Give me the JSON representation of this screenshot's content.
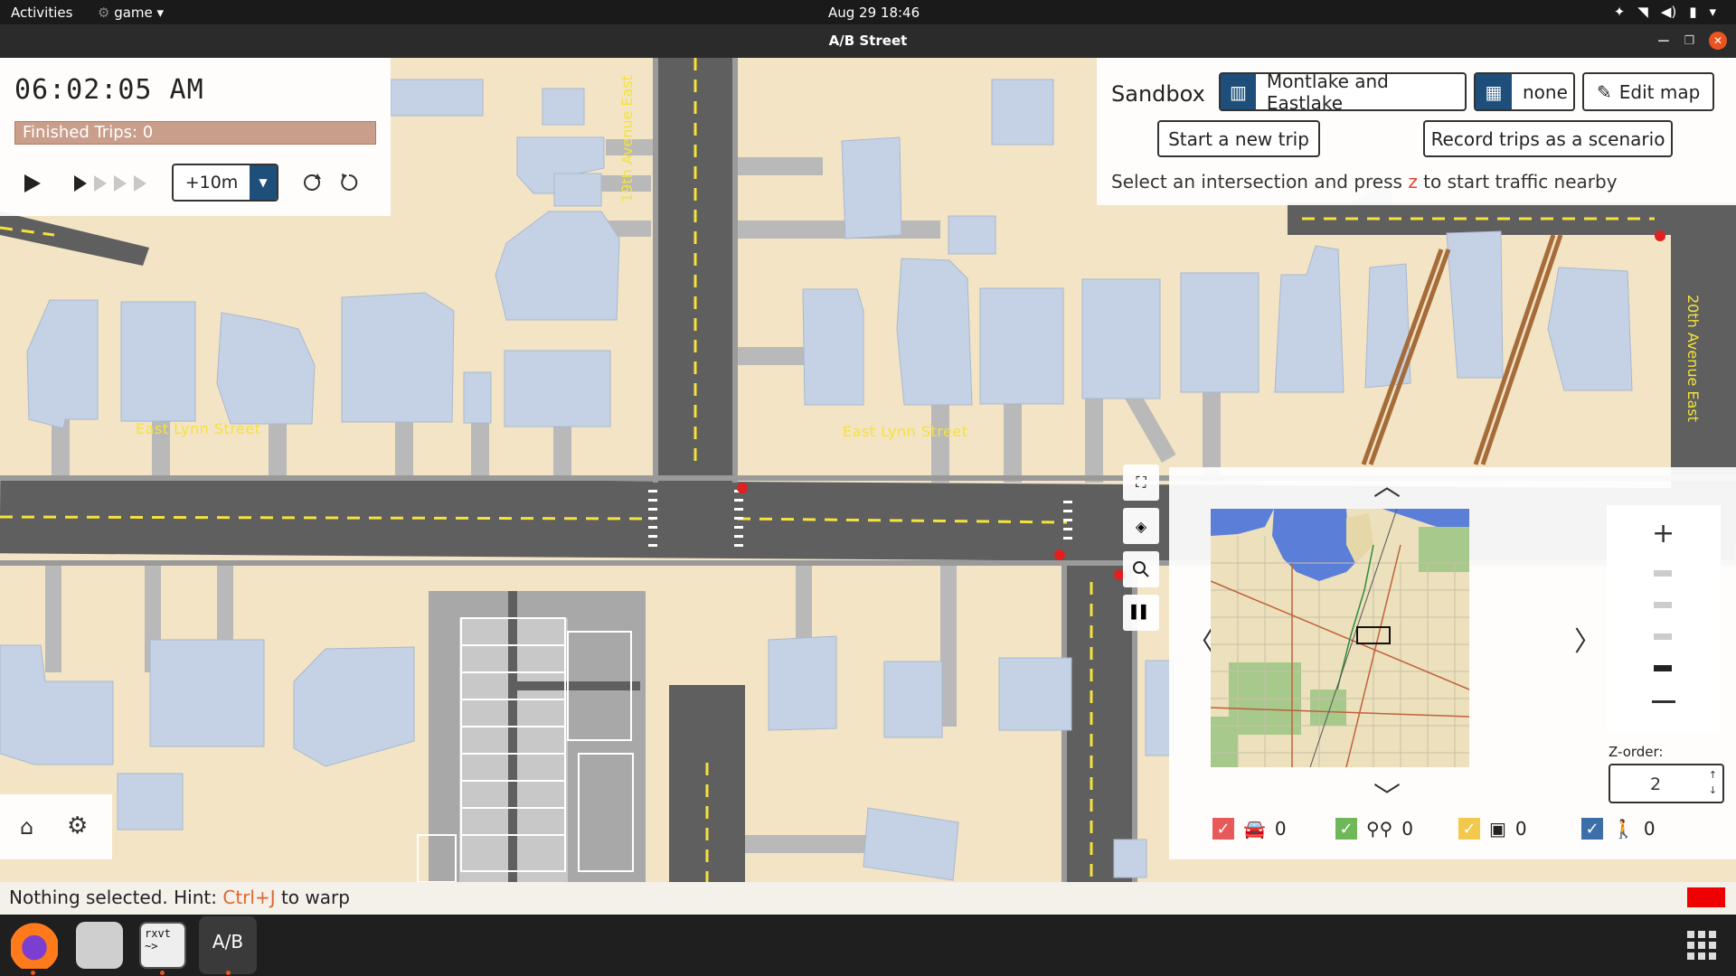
{
  "topbar": {
    "activities": "Activities",
    "app_menu": "game",
    "clock": "Aug 29  18:46"
  },
  "window": {
    "title": "A/B Street"
  },
  "time_panel": {
    "clock": "06:02:05 AM",
    "finished_trips": "Finished Trips: 0",
    "step_value": "+10m"
  },
  "sandbox": {
    "title": "Sandbox",
    "map_name": "Montlake and Eastlake",
    "scenario": "none",
    "edit_map": "Edit map",
    "start_trip": "Start a new trip",
    "record_trips": "Record trips as a scenario",
    "hint_before": "Select an intersection and press ",
    "hint_key": "z",
    "hint_after": " to start traffic nearby"
  },
  "map_labels": {
    "east_lynn_1": "East Lynn Street",
    "east_lynn_2": "East Lynn Street",
    "avenue_19": "19th Avenue East",
    "avenue_20": "20th Avenue East"
  },
  "minimap_panel": {
    "z_order_label": "Z-order:",
    "z_order_value": "2",
    "filters": [
      {
        "name": "cars",
        "count": "0",
        "color": "#e85a5a",
        "icon": "car-icon"
      },
      {
        "name": "bikes",
        "count": "0",
        "color": "#6fb85a",
        "icon": "bike-icon"
      },
      {
        "name": "buses",
        "count": "0",
        "color": "#f2c94c",
        "icon": "bus-icon"
      },
      {
        "name": "pedestrians",
        "count": "0",
        "color": "#3c6fa8",
        "icon": "pedestrian-icon"
      }
    ]
  },
  "status_bar": {
    "before": "Nothing selected. Hint: ",
    "key": "Ctrl+J",
    "after": " to warp"
  },
  "colors": {
    "accent": "#1e4f7a",
    "trips_bar": "#c99e8a",
    "road": "#5f5f5f",
    "building": "#c5d2e6",
    "ground": "#f2e4c4",
    "lane_marking": "#f5e23c"
  }
}
